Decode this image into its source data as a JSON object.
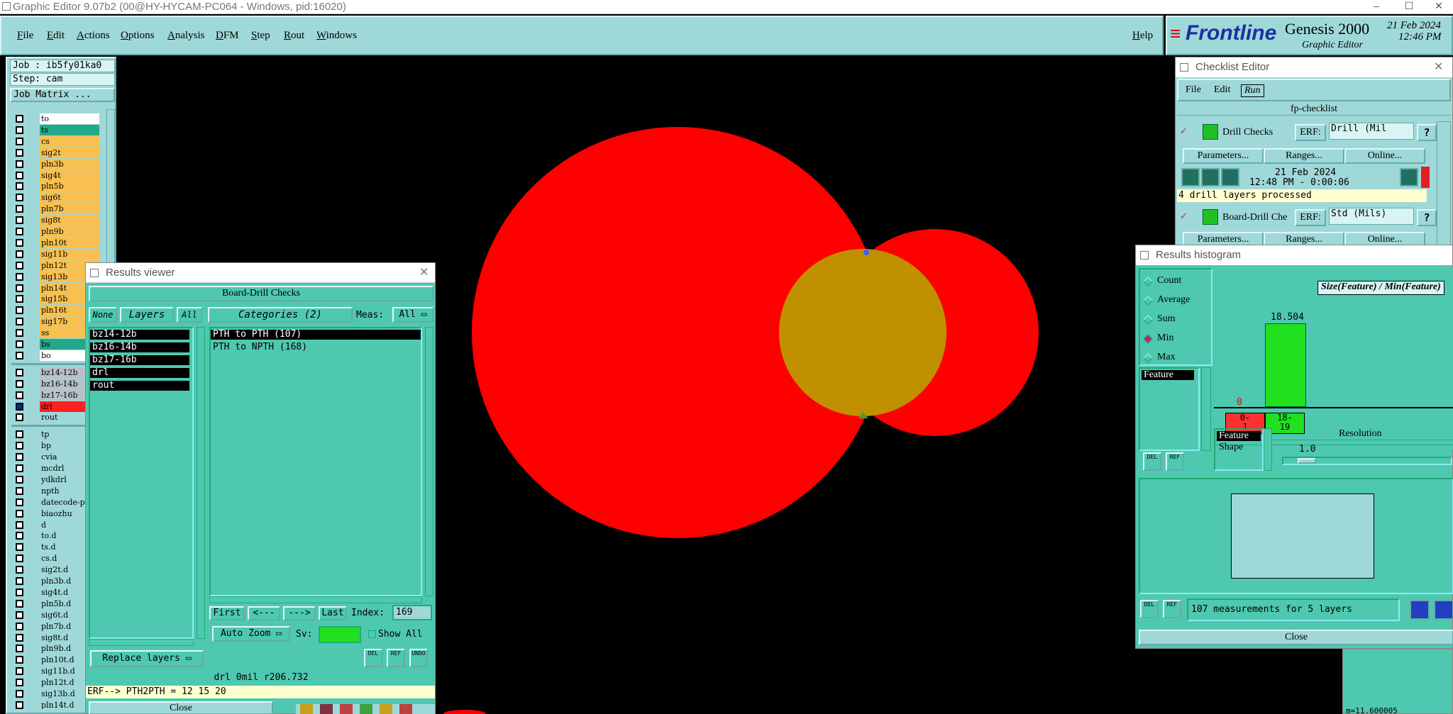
{
  "window": {
    "title": "Graphic Editor 9.07b2 (00@HY-HYCAM-PC064 - Windows, pid:16020)",
    "min": "–",
    "max": "☐",
    "close": "✕"
  },
  "menu": {
    "items": [
      "File",
      "Edit",
      "Actions",
      "Options",
      "Analysis",
      "DFM",
      "Step",
      "Rout",
      "Windows"
    ],
    "help": "Help"
  },
  "brand": {
    "logo": "Frontline",
    "product": "Genesis 2000",
    "subtitle": "Graphic Editor",
    "date": "21 Feb 2024",
    "time": "12:46 PM"
  },
  "left": {
    "job": "Job : ib5fy01ka0",
    "step": "Step: cam",
    "job_matrix": "Job Matrix ...",
    "layers_a": [
      {
        "name": "to",
        "color": "#ffffff"
      },
      {
        "name": "ts",
        "color": "#22a88a"
      },
      {
        "name": "cs",
        "color": "#f8c050"
      },
      {
        "name": "sig2t",
        "color": "#f8c050"
      },
      {
        "name": "pln3b",
        "color": "#f8c050"
      },
      {
        "name": "sig4t",
        "color": "#f8c050"
      },
      {
        "name": "pln5b",
        "color": "#f8c050"
      },
      {
        "name": "sig6t",
        "color": "#f8c050"
      },
      {
        "name": "pln7b",
        "color": "#f8c050"
      },
      {
        "name": "sig8t",
        "color": "#f8c050"
      },
      {
        "name": "pln9b",
        "color": "#f8c050"
      },
      {
        "name": "pln10t",
        "color": "#f8c050"
      },
      {
        "name": "sig11b",
        "color": "#f8c050"
      },
      {
        "name": "pln12t",
        "color": "#f8c050"
      },
      {
        "name": "sig13b",
        "color": "#f8c050"
      },
      {
        "name": "pln14t",
        "color": "#f8c050"
      },
      {
        "name": "sig15b",
        "color": "#f8c050"
      },
      {
        "name": "pln16t",
        "color": "#f8c050"
      },
      {
        "name": "sig17b",
        "color": "#f8c050"
      },
      {
        "name": "ss",
        "color": "#f8c050"
      },
      {
        "name": "bs",
        "color": "#22a88a"
      },
      {
        "name": "bo",
        "color": "#ffffff"
      }
    ],
    "layers_b": [
      {
        "name": "bz14-12b",
        "color": "#b8c0c8"
      },
      {
        "name": "bz16-14b",
        "color": "#b8c0c8"
      },
      {
        "name": "bz17-16b",
        "color": "#b8c0c8"
      },
      {
        "name": "drl",
        "color": "#ff2020",
        "on": true
      },
      {
        "name": "rout",
        "color": "#9fd8d8"
      }
    ],
    "layers_c": [
      "tp",
      "bp",
      "cvia",
      "mcdrl",
      "ydkdrl",
      "npth",
      "datecode-p",
      "biaozhu",
      "d",
      "to.d",
      "ts.d",
      "cs.d",
      "sig2t.d",
      "pln3b.d",
      "sig4t.d",
      "pln5b.d",
      "sig6t.d",
      "pln7b.d",
      "sig8t.d",
      "pln9b.d",
      "pln10t.d",
      "sig11b.d",
      "pln12t.d",
      "sig13b.d",
      "pln14t.d"
    ]
  },
  "results_viewer": {
    "title": "Results viewer",
    "heading": "Board-Drill Checks",
    "none": "None",
    "layers": "Layers",
    "all": "All",
    "categories": "Categories (2)",
    "meas_label": "Meas:",
    "meas_value": "All",
    "layer_list": [
      "bz14-12b",
      "bz16-14b",
      "bz17-16b",
      "drl",
      "rout"
    ],
    "category_list": [
      "PTH to PTH  (107)",
      "PTH to NPTH  (168)"
    ],
    "first": "First",
    "prev": "<---",
    "next": "--->",
    "last": "Last",
    "index_label": "Index:",
    "index_value": "169",
    "auto_zoom": "Auto Zoom",
    "sv_label": "Sv:",
    "show_all": "Show All",
    "replace_layers": "Replace layers",
    "status1": "drl 0mil  r206.732",
    "status2": "ERF--> PTH2PTH = 12 15 20",
    "close": "Close",
    "del": "DEL",
    "ref": "REF",
    "undo": "UNDO"
  },
  "checklist": {
    "title": "Checklist Editor",
    "menu": [
      "File",
      "Edit",
      "Run"
    ],
    "name": "fp-checklist",
    "item1": {
      "name": "Drill Checks",
      "erf_label": "ERF:",
      "erf_value": "Drill (Mil",
      "params": "Parameters...",
      "ranges": "Ranges...",
      "online": "Online...",
      "date": "21 Feb 2024",
      "time": "12:48 PM - 0:00:06",
      "status": "4 drill layers processed"
    },
    "item2": {
      "name": "Board-Drill Che",
      "erf_label": "ERF:",
      "erf_value": "Std (Mils)",
      "params": "Parameters...",
      "ranges": "Ranges...",
      "online": "Online..."
    },
    "help": "?"
  },
  "histogram": {
    "title": "Results histogram",
    "options": [
      "Count",
      "Average",
      "Sum",
      "Min",
      "Max"
    ],
    "selected": "Min",
    "feature": "Feature",
    "chart_title": "Size(Feature) / Min(Feature)",
    "bar_value": "18.504",
    "zero": "0",
    "bin1": "0-\n1",
    "bin2": "18-\n19",
    "feature_shape": [
      "Feature",
      "Shape"
    ],
    "resolution_label": "Resolution",
    "resolution_value": "1.0",
    "footer": "107 measurements for 5 layers",
    "close": "Close",
    "del": "DEL",
    "ref": "REF"
  },
  "bottom_right": "m=11.600005",
  "colors": {
    "bg": "#000000",
    "panel": "#9fd8d8",
    "rv": "#4fc8b0",
    "pad": "#ff0000",
    "overlap": "#c09000"
  }
}
